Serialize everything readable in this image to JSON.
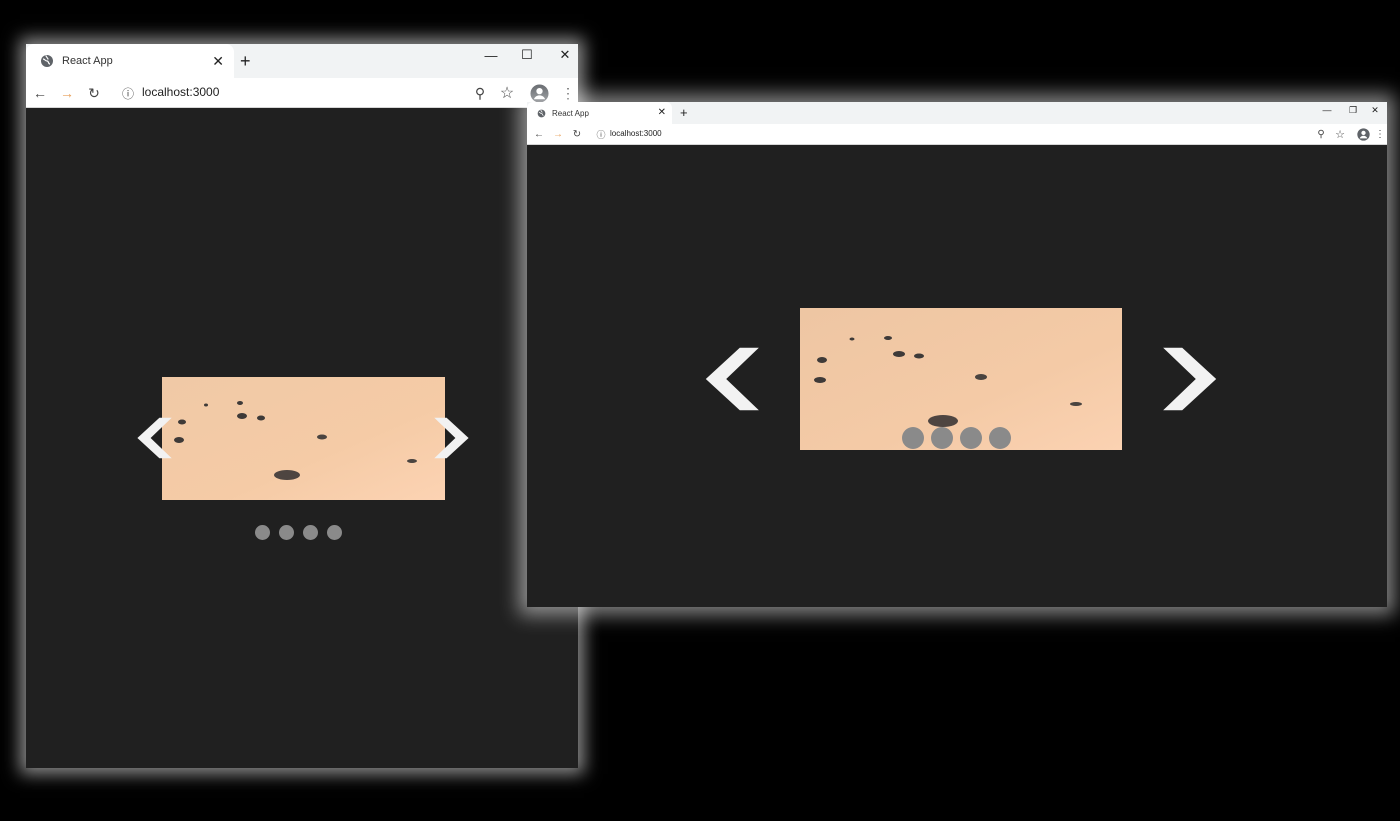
{
  "browser": {
    "tab_title": "React App",
    "url": "localhost:3000",
    "close_glyph": "✕",
    "new_tab_glyph": "+",
    "minimize_glyph": "—",
    "maximize_glyph": "☐",
    "restore_glyph": "❐",
    "window_close_glyph": "✕",
    "back_glyph": "←",
    "forward_glyph": "→",
    "reload_glyph": "↻",
    "info_glyph": "ⓘ",
    "zoom_glyph": "⚲",
    "star_glyph": "☆",
    "menu_glyph": "⋮"
  },
  "carousel": {
    "slide_count": 4,
    "prev_icon": "chevron-left-icon",
    "next_icon": "chevron-right-icon",
    "image": "sand-beach-with-pebbles",
    "dot_color": "#8a8a8a",
    "arrow_color": "#f2f2f2",
    "background": "#202020"
  }
}
